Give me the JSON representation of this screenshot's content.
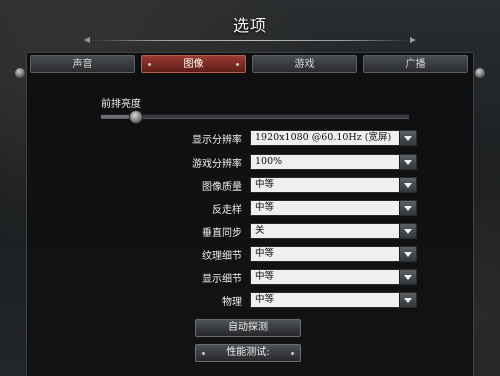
{
  "window": {
    "title": "选项"
  },
  "tabs": [
    {
      "label": "声音",
      "active": false
    },
    {
      "label": "图像",
      "active": true
    },
    {
      "label": "游戏",
      "active": false
    },
    {
      "label": "广播",
      "active": false
    }
  ],
  "brightness": {
    "label": "前排亮度",
    "level_percent": 11
  },
  "settings": [
    {
      "label": "显示分辨率",
      "value": "1920x1080 @60.10Hz (宽屏)"
    },
    {
      "label": "游戏分辨率",
      "value": "100%"
    },
    {
      "label": "图像质量",
      "value": "中等"
    },
    {
      "label": "反走样",
      "value": "中等"
    },
    {
      "label": "垂直同步",
      "value": "关"
    },
    {
      "label": "纹理细节",
      "value": "中等"
    },
    {
      "label": "显示细节",
      "value": "中等"
    },
    {
      "label": "物理",
      "value": "中等"
    }
  ],
  "buttons": {
    "auto_detect": "自动探测",
    "benchmark": "性能测试:"
  },
  "colors": {
    "active_tab": "#8a3028",
    "dropdown_bg": "#efefef",
    "background": "#121314"
  },
  "icons": [
    "chevron-down-icon",
    "slider-thumb",
    "orb-icon"
  ]
}
